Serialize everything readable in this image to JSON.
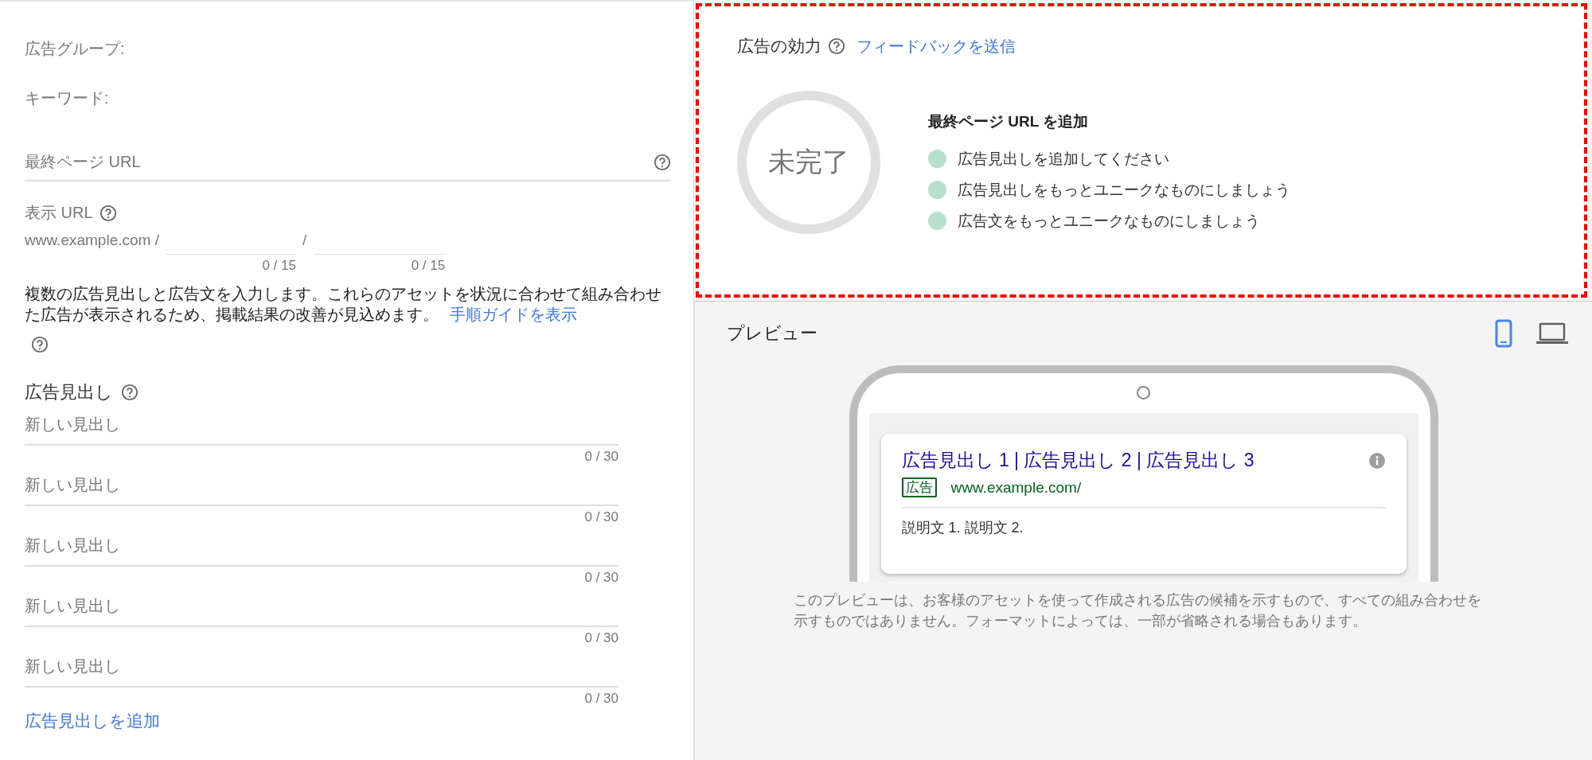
{
  "ad_group": {
    "label": "広告グループ:"
  },
  "keyword": {
    "label": "キーワード:"
  },
  "final_url": {
    "placeholder": "最終ページ URL"
  },
  "display_url": {
    "label": "表示 URL",
    "domain": "www.example.com /",
    "separator": "/",
    "path_counters": [
      "0 / 15",
      "0 / 15"
    ]
  },
  "intro": {
    "text": "複数の広告見出しと広告文を入力します。これらのアセットを状況に合わせて組み合わせた広告が表示されるため、掲載結果の改善が見込めます。",
    "link": "手順ガイドを表示"
  },
  "headlines": {
    "title": "広告見出し",
    "fields": [
      {
        "placeholder": "新しい見出し",
        "counter": "0 / 30"
      },
      {
        "placeholder": "新しい見出し",
        "counter": "0 / 30"
      },
      {
        "placeholder": "新しい見出し",
        "counter": "0 / 30"
      },
      {
        "placeholder": "新しい見出し",
        "counter": "0 / 30"
      },
      {
        "placeholder": "新しい見出し",
        "counter": "0 / 30"
      }
    ],
    "add_link": "広告見出しを追加"
  },
  "ad_strength": {
    "title": "広告の効力",
    "feedback_link": "フィードバックを送信",
    "rating": "未完了",
    "heading": "最終ページ URL を追加",
    "suggestions": [
      "広告見出しを追加してください",
      "広告見出しをもっとユニークなものにしましょう",
      "広告文をもっとユニークなものにしましょう"
    ]
  },
  "preview": {
    "title": "プレビュー",
    "devices": [
      {
        "kind": "mobile",
        "selected": true
      },
      {
        "kind": "desktop",
        "selected": false
      }
    ],
    "ad": {
      "headline": "広告見出し 1 | 広告見出し 2 | 広告見出し 3",
      "badge": "広告",
      "url": "www.example.com/",
      "description": "説明文 1. 説明文 2."
    },
    "disclaimer": "このプレビューは、お客様のアセットを使って作成される広告の候補を示すもので、すべての組み合わせを示すものではありません。フォーマットによっては、一部が省略される場合もあります。"
  }
}
